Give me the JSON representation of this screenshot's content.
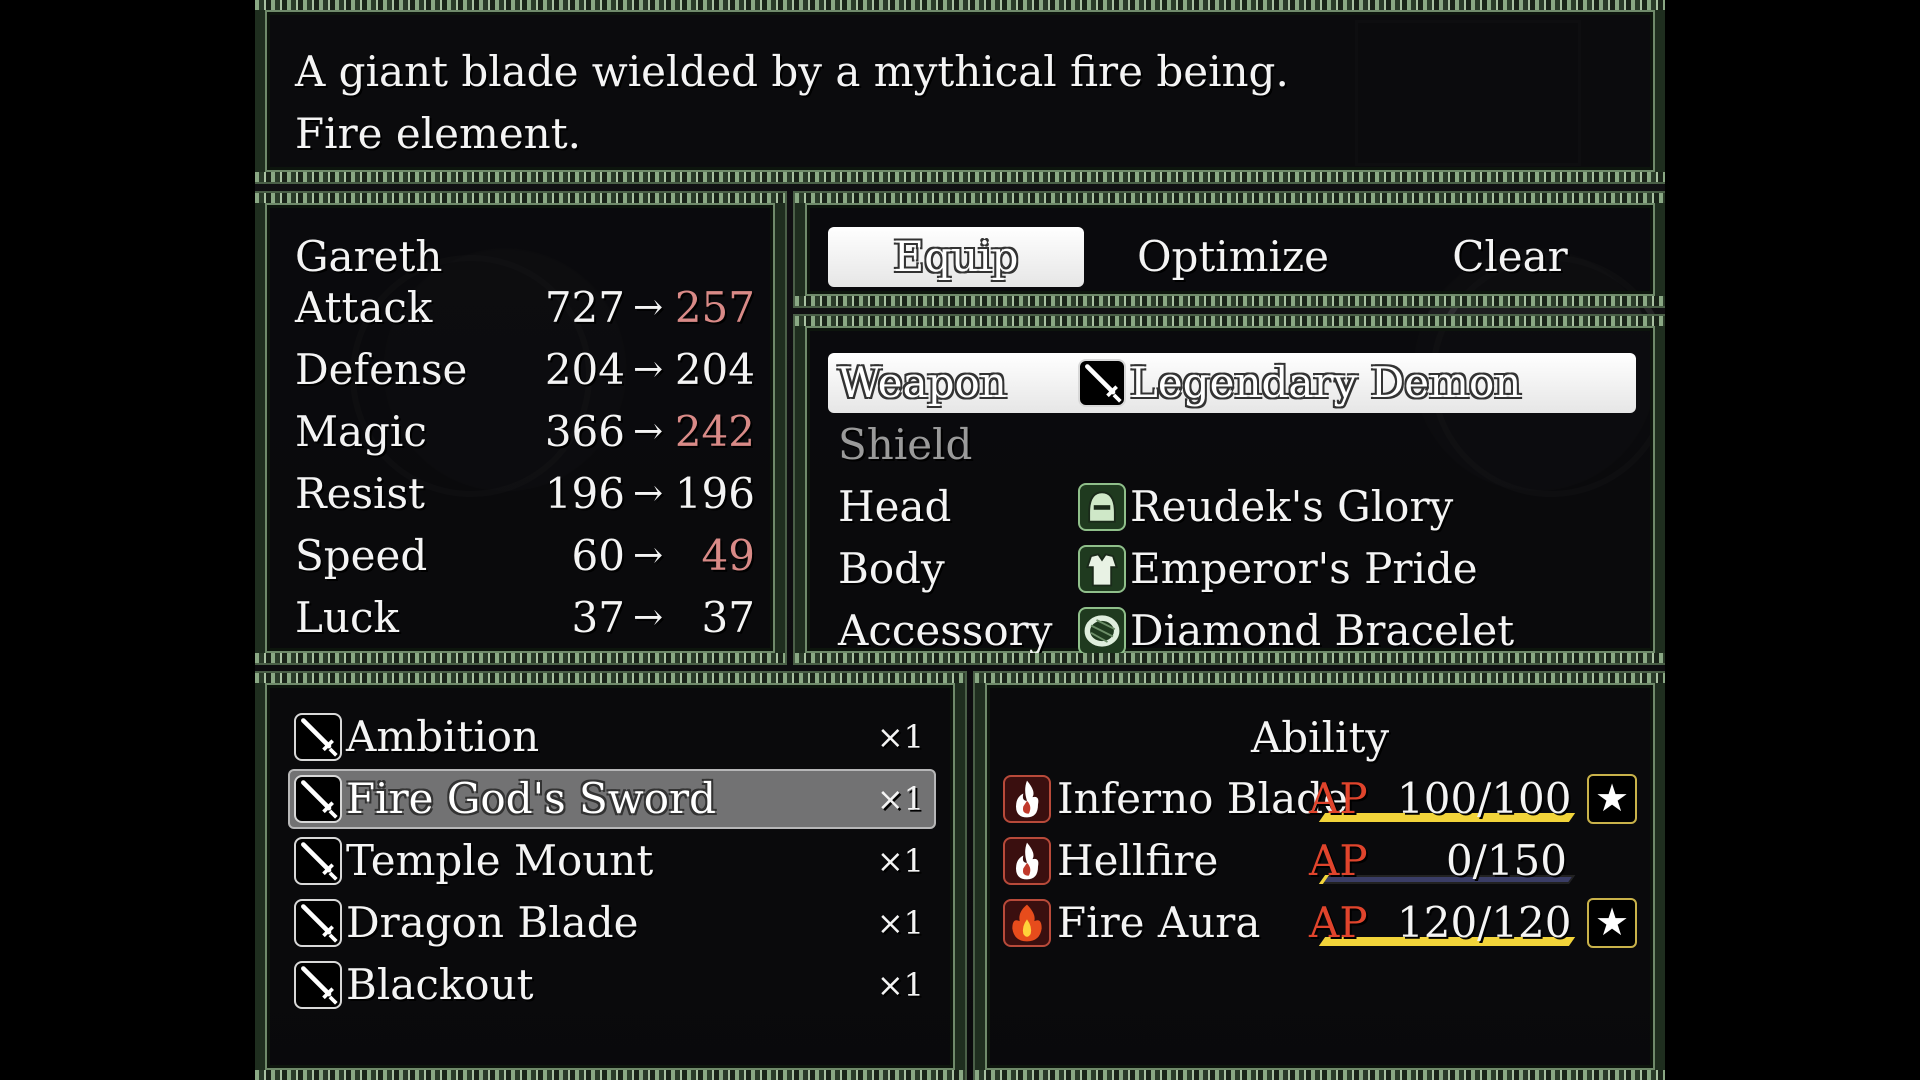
{
  "description": {
    "line1": "A giant blade wielded by a mythical fire being.",
    "line2": "Fire element."
  },
  "status": {
    "character": "Gareth",
    "arrow": "→",
    "stats": [
      {
        "label": "Attack",
        "current": "727",
        "new": "257",
        "change": "down"
      },
      {
        "label": "Defense",
        "current": "204",
        "new": "204",
        "change": "same"
      },
      {
        "label": "Magic",
        "current": "366",
        "new": "242",
        "change": "down"
      },
      {
        "label": "Resist",
        "current": "196",
        "new": "196",
        "change": "same"
      },
      {
        "label": "Speed",
        "current": "60",
        "new": "49",
        "change": "down"
      },
      {
        "label": "Luck",
        "current": "37",
        "new": "37",
        "change": "same"
      }
    ]
  },
  "commands": {
    "equip": "Equip",
    "optimize": "Optimize",
    "clear": "Clear",
    "selected": "equip"
  },
  "slots": [
    {
      "slot": "Weapon",
      "item": "Legendary Demon",
      "icon": "sword-icon"
    },
    {
      "slot": "Shield",
      "item": "",
      "icon": ""
    },
    {
      "slot": "Head",
      "item": "Reudek's Glory",
      "icon": "helmet-icon"
    },
    {
      "slot": "Body",
      "item": "Emperor's Pride",
      "icon": "armor-icon"
    },
    {
      "slot": "Accessory",
      "item": "Diamond Bracelet",
      "icon": "bracelet-icon"
    }
  ],
  "inventory": [
    {
      "name": "Ambition",
      "qty": "×1",
      "icon": "sword-icon"
    },
    {
      "name": "Fire God's Sword",
      "qty": "×1",
      "icon": "sword-icon",
      "selected": true
    },
    {
      "name": "Temple Mount",
      "qty": "×1",
      "icon": "sword-icon"
    },
    {
      "name": "Dragon Blade",
      "qty": "×1",
      "icon": "sword-icon"
    },
    {
      "name": "Blackout",
      "qty": "×1",
      "icon": "sword-icon"
    }
  ],
  "ability": {
    "title": "Ability",
    "ap_label": "AP",
    "list": [
      {
        "name": "Inferno Blade",
        "ap": "100/100",
        "fraction": 1.0,
        "mastered": true,
        "icon": "flame-icon"
      },
      {
        "name": "Hellfire",
        "ap": "0/150",
        "fraction": 0.0,
        "mastered": false,
        "icon": "flame-icon"
      },
      {
        "name": "Fire Aura",
        "ap": "120/120",
        "fraction": 1.0,
        "mastered": true,
        "icon": "fire-aura-icon"
      }
    ],
    "star": "★"
  },
  "colors": {
    "stat_down": "#d98a87",
    "ap_label": "#e0442c",
    "ap_bar_full": "#f2d43a",
    "ap_bar_empty": "#3a3d66",
    "frame_green": "#6f8a6a"
  }
}
